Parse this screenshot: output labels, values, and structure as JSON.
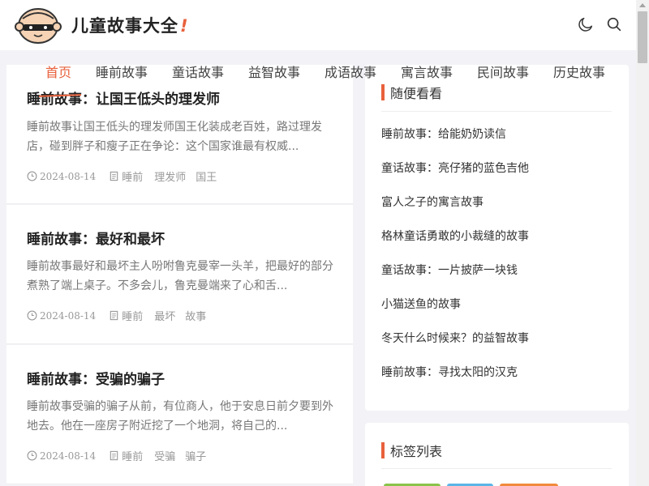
{
  "site": {
    "title": "儿童故事大全",
    "title_mark": "!"
  },
  "nav": [
    {
      "label": "首页"
    },
    {
      "label": "睡前故事"
    },
    {
      "label": "童话故事"
    },
    {
      "label": "益智故事"
    },
    {
      "label": "成语故事"
    },
    {
      "label": "寓言故事"
    },
    {
      "label": "民间故事"
    },
    {
      "label": "历史故事"
    }
  ],
  "posts": [
    {
      "title": "睡前故事：让国王低头的理发师",
      "excerpt": "睡前故事让国王低头的理发师国王化装成老百姓，路过理发店，碰到胖子和瘦子正在争论：这个国家谁最有权威...",
      "date": "2024-08-14",
      "category": "睡前",
      "tags": [
        "理发师",
        "国王"
      ]
    },
    {
      "title": "睡前故事：最好和最坏",
      "excerpt": "睡前故事最好和最坏主人吩咐鲁克曼宰一头羊，把最好的部分煮熟了端上桌子。不多会儿，鲁克曼端来了心和舌...",
      "date": "2024-08-14",
      "category": "睡前",
      "tags": [
        "最坏",
        "故事"
      ]
    },
    {
      "title": "睡前故事：受骗的骗子",
      "excerpt": "睡前故事受骗的骗子从前，有位商人，他于安息日前夕要到外地去。他在一座房子附近挖了一个地洞，将自己的...",
      "date": "2024-08-14",
      "category": "睡前",
      "tags": [
        "受骗",
        "骗子"
      ]
    }
  ],
  "sidebar": {
    "random": {
      "heading": "随便看看",
      "items": [
        "睡前故事：给能奶奶读信",
        "童话故事：亮仔猪的蓝色吉他",
        "富人之子的寓言故事",
        "格林童话勇敢的小裁缝的故事",
        "童话故事：一片披萨一块钱",
        "小猫送鱼的故事",
        "冬天什么时候来？的益智故事",
        "睡前故事：寻找太阳的汉克"
      ]
    },
    "tags": {
      "heading": "标签列表"
    }
  },
  "colors": {
    "accent": "#e8613c",
    "tag_green": "#8bc34a",
    "tag_blue": "#5bb5e6",
    "tag_orange": "#f08a3c"
  }
}
